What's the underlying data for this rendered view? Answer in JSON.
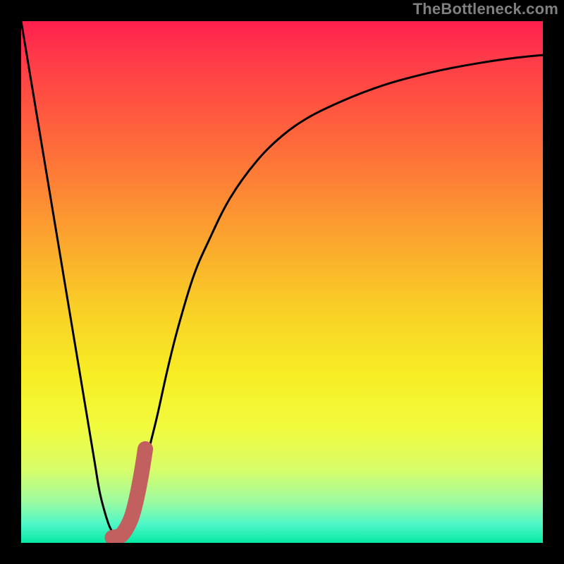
{
  "watermark": "TheBottleneck.com",
  "colors": {
    "frame": "#000000",
    "watermark": "#808080",
    "curve": "#000000",
    "fat_segment": "#c1605f",
    "gradient_stops": [
      {
        "offset": 0.0,
        "color": "#ff1f4d"
      },
      {
        "offset": 0.07,
        "color": "#ff3a49"
      },
      {
        "offset": 0.18,
        "color": "#ff5a3f"
      },
      {
        "offset": 0.3,
        "color": "#fd7e36"
      },
      {
        "offset": 0.42,
        "color": "#fba62e"
      },
      {
        "offset": 0.55,
        "color": "#f9cf26"
      },
      {
        "offset": 0.68,
        "color": "#f7ee25"
      },
      {
        "offset": 0.78,
        "color": "#f1fb3e"
      },
      {
        "offset": 0.86,
        "color": "#d7fd69"
      },
      {
        "offset": 0.92,
        "color": "#9efba0"
      },
      {
        "offset": 0.965,
        "color": "#4df7c8"
      },
      {
        "offset": 1.0,
        "color": "#07e9a3"
      }
    ]
  },
  "chart_data": {
    "type": "line",
    "title": "",
    "xlabel": "",
    "ylabel": "",
    "xlim": [
      0,
      100
    ],
    "ylim": [
      0,
      100
    ],
    "series": [
      {
        "name": "bottleneck-curve",
        "x": [
          0,
          2,
          4,
          6,
          8,
          10,
          12,
          14,
          15,
          16,
          17,
          18,
          19,
          20,
          21,
          22,
          24,
          26,
          28,
          30,
          33,
          36,
          40,
          45,
          50,
          55,
          60,
          66,
          72,
          80,
          88,
          95,
          100
        ],
        "y": [
          100,
          88,
          76,
          64,
          52,
          40,
          28,
          16,
          10,
          6,
          3,
          1.5,
          1,
          2,
          4,
          8,
          16,
          24,
          33,
          41,
          51,
          58,
          66,
          73,
          78,
          81.5,
          84,
          86.5,
          88.5,
          90.5,
          92,
          93,
          93.5
        ]
      },
      {
        "name": "fat-highlight-segment",
        "x": [
          17.5,
          18.5,
          19.5,
          21.0,
          22.0,
          23.0,
          23.8
        ],
        "y": [
          1.0,
          1.2,
          1.8,
          4.5,
          8.0,
          13.0,
          18.0
        ]
      }
    ],
    "annotations": []
  }
}
